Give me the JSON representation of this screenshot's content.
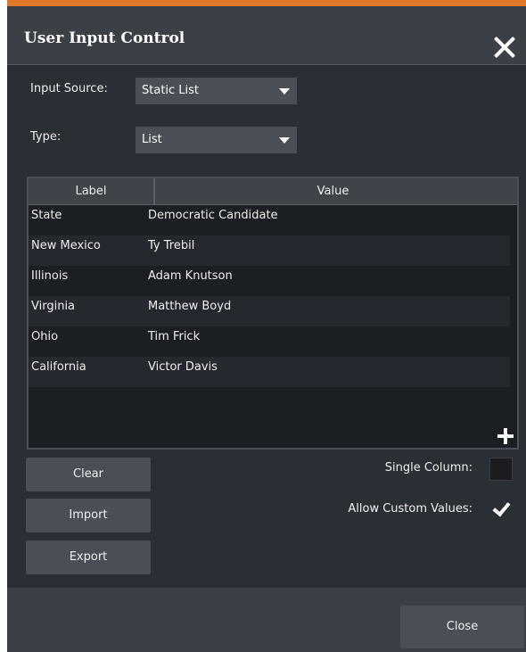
{
  "dialog": {
    "title": "User Input Control",
    "accent_color": "#e0782c",
    "close_icon": "close-icon"
  },
  "form": {
    "input_source_label": "Input Source:",
    "input_source_value": "Static List",
    "type_label": "Type:",
    "type_value": "List"
  },
  "table": {
    "columns": [
      "Label",
      "Value"
    ],
    "rows": [
      {
        "label": "State",
        "value": "Democratic Candidate"
      },
      {
        "label": "New Mexico",
        "value": "Ty Trebil"
      },
      {
        "label": "Illinois",
        "value": "Adam Knutson"
      },
      {
        "label": "Virginia",
        "value": "Matthew Boyd"
      },
      {
        "label": "Ohio",
        "value": "Tim Frick"
      },
      {
        "label": "California",
        "value": "Victor Davis"
      }
    ],
    "add_icon": "plus-icon"
  },
  "buttons": {
    "clear": "Clear",
    "import": "Import",
    "export": "Export",
    "close": "Close"
  },
  "options": {
    "single_column_label": "Single Column:",
    "single_column_checked": false,
    "allow_custom_label": "Allow Custom Values:",
    "allow_custom_checked": true
  }
}
